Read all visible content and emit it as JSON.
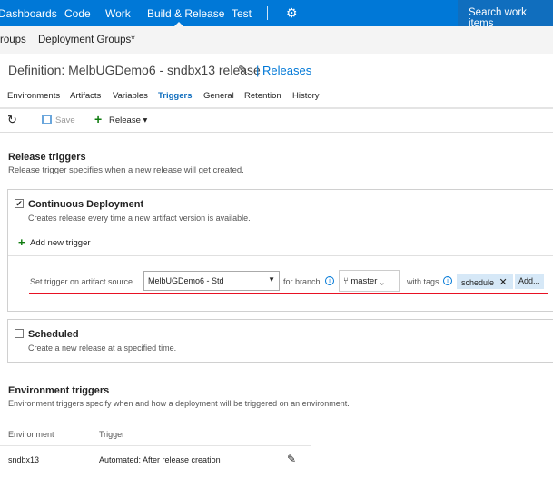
{
  "topnav": {
    "items": [
      "Dashboards",
      "Code",
      "Work",
      "Build & Release",
      "Test"
    ],
    "search": "Search work items",
    "accent": "#0078d7"
  },
  "subnav": {
    "items": [
      "roups",
      "Deployment Groups*"
    ]
  },
  "header": {
    "title": "Definition: MelbUGDemo6 - sndbx13 release",
    "releases_link": "Releases"
  },
  "tabs": [
    "Environments",
    "Artifacts",
    "Variables",
    "Triggers",
    "General",
    "Retention",
    "History"
  ],
  "active_tab": "Triggers",
  "toolbar": {
    "save": "Save",
    "release": "Release"
  },
  "release_triggers": {
    "title": "Release triggers",
    "desc": "Release trigger specifies when a new release will get created."
  },
  "cd": {
    "title": "Continuous Deployment",
    "desc": "Creates release every time a new artifact version is available.",
    "checked": true,
    "add_trigger": "Add new trigger",
    "set_label": "Set trigger on artifact source",
    "source": "MelbUGDemo6 - Std",
    "branch_label": "for branch",
    "branch": "master",
    "tags_label": "with tags",
    "tag": "schedule",
    "add": "Add..."
  },
  "scheduled": {
    "title": "Scheduled",
    "desc": "Create a new release at a specified time.",
    "checked": false
  },
  "env_triggers": {
    "title": "Environment triggers",
    "desc": "Environment triggers specify when and how a deployment will be triggered on an environment.",
    "headers": [
      "Environment",
      "Trigger"
    ],
    "rows": [
      {
        "env": "sndbx13",
        "trigger": "Automated: After release creation"
      }
    ]
  }
}
